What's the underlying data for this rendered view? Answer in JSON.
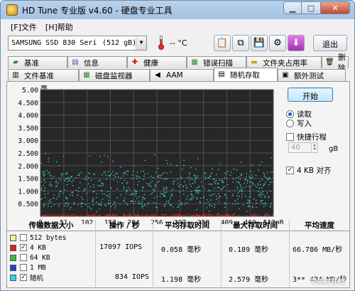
{
  "window": {
    "title": "HD Tune 专业版 v4.60 - 硬盘专业工具"
  },
  "menu": {
    "items": [
      "[F]文件",
      "[H]帮助"
    ]
  },
  "toolbar": {
    "drive_name": "SAMSUNG SSD 830 Seri",
    "drive_capacity": "(512 gB)",
    "temperature": "-- °C",
    "exit_label": "退出"
  },
  "tabs_top": [
    {
      "label": "基准",
      "icon": "benchmark-icon"
    },
    {
      "label": "信息",
      "icon": "info-icon"
    },
    {
      "label": "健康",
      "icon": "health-icon"
    },
    {
      "label": "错误扫描",
      "icon": "error-scan-icon"
    },
    {
      "label": "文件夹占用率",
      "icon": "folder-icon"
    },
    {
      "label": "删除",
      "icon": "delete-icon"
    }
  ],
  "tabs_bottom": [
    {
      "label": "文件基准",
      "icon": "file-benchmark-icon"
    },
    {
      "label": "磁盘监视器",
      "icon": "disk-monitor-icon"
    },
    {
      "label": "AAM",
      "icon": "speaker-icon"
    },
    {
      "label": "随机存取",
      "icon": "random-access-icon",
      "active": true
    },
    {
      "label": "额外测试",
      "icon": "extra-tests-icon"
    }
  ],
  "controls": {
    "start_label": "开始",
    "read_label": "读取",
    "write_label": "写入",
    "read_selected": true,
    "quick_label": "快捷行程",
    "quick_checked": false,
    "quick_value": "40",
    "quick_unit": "gB",
    "align_label": "4 KB 对齐",
    "align_checked": true
  },
  "chart_data": {
    "type": "scatter",
    "ylabel": "毫秒",
    "y_ticks": [
      "5.00",
      "4.500",
      "4.000",
      "3.500",
      "3.000",
      "2.500",
      "2.000",
      "1.500",
      "1.000",
      "0.500"
    ],
    "x_ticks": [
      "0",
      "51",
      "102",
      "153",
      "204",
      "256",
      "307",
      "358",
      "409",
      "460",
      "512gB"
    ],
    "ylim": [
      0,
      5
    ],
    "xlim": [
      0,
      512
    ],
    "grid": true,
    "series": [
      {
        "name": "4 KB",
        "color": "#e02020",
        "y_center": 0.06,
        "y_spread": 0.04
      },
      {
        "name": "随机",
        "color": "#3ad0e0",
        "y_center": 1.2,
        "y_spread": 1.0
      }
    ]
  },
  "table": {
    "headers": [
      "传输数据大小",
      "操作 / 秒",
      "平均存取时间",
      "最大存取时间",
      "平均速度"
    ],
    "rows": [
      {
        "label": "512 bytes",
        "color": "#f2f28c",
        "checked": false,
        "ops": "",
        "avg": "",
        "max": "",
        "speed": ""
      },
      {
        "label": "4 KB",
        "color": "#e02020",
        "checked": true,
        "ops": "17097 IOPS",
        "avg": "0.058 毫秒",
        "max": "0.189 毫秒",
        "speed": "66.786 MB/秒"
      },
      {
        "label": "64 KB",
        "color": "#30c030",
        "checked": false,
        "ops": "",
        "avg": "",
        "max": "",
        "speed": ""
      },
      {
        "label": "1 MB",
        "color": "#2040d0",
        "checked": false,
        "ops": "",
        "avg": "",
        "max": "",
        "speed": ""
      },
      {
        "label": "随机",
        "color": "#3ad0e0",
        "checked": true,
        "ops": "834 IOPS",
        "avg": "1.198 毫秒",
        "max": "2.579 毫秒",
        "speed": "3** 424 MB/秒"
      }
    ]
  },
  "watermark": "中关村在线"
}
